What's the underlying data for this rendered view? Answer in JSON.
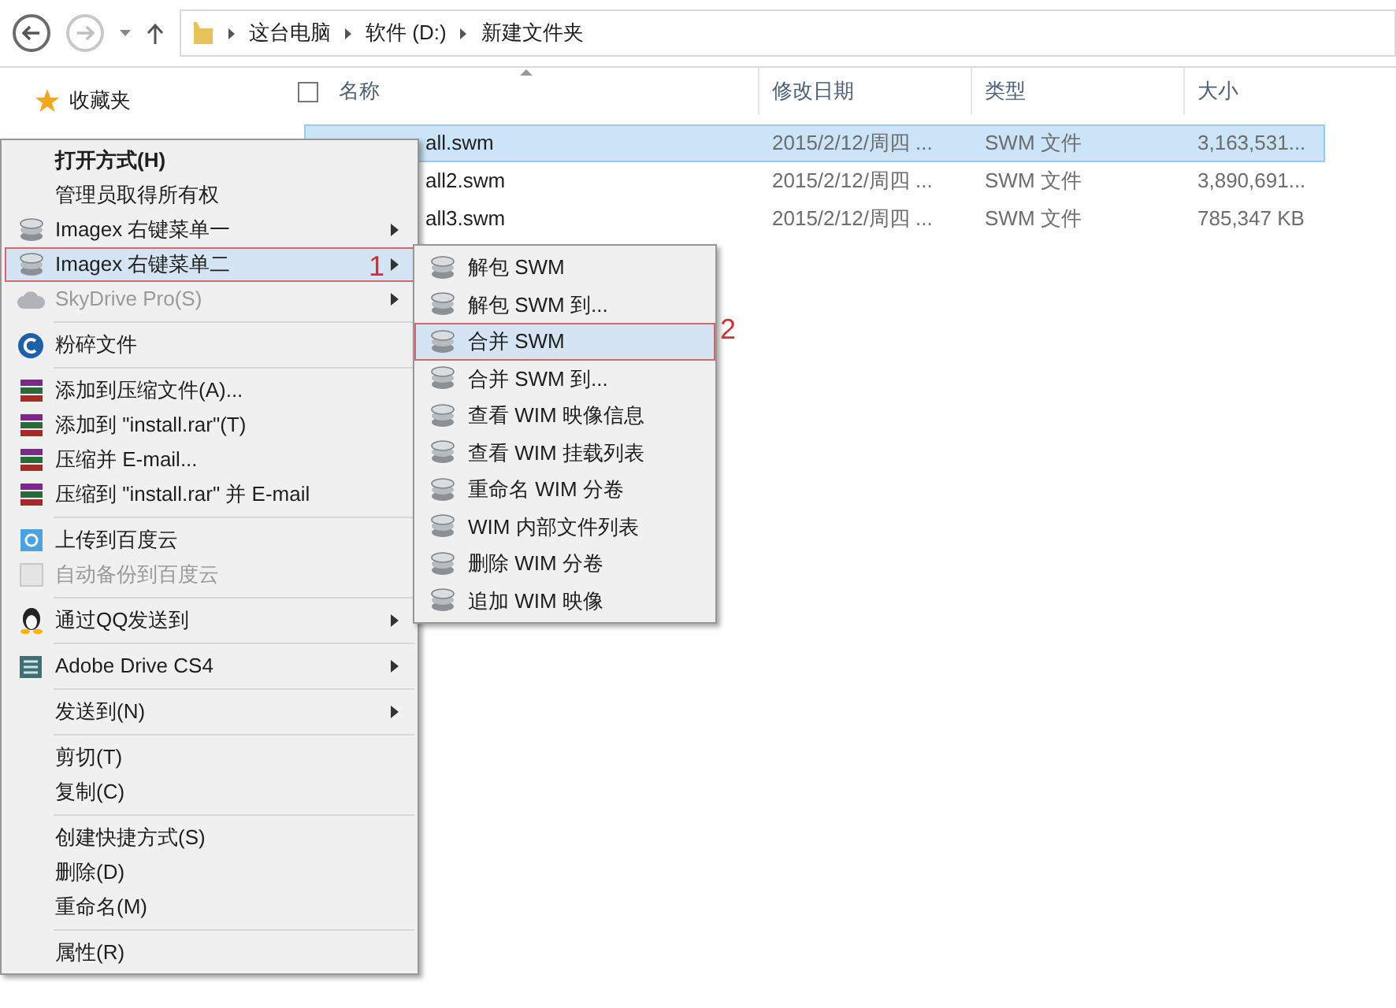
{
  "address_bar": {
    "crumbs": [
      "这台电脑",
      "软件 (D:)",
      "新建文件夹"
    ]
  },
  "nav_pane": {
    "items": [
      {
        "label": "收藏夹"
      }
    ]
  },
  "file_list": {
    "select_all": {
      "checked": false
    },
    "columns": [
      "名称",
      "修改日期",
      "类型",
      "大小"
    ],
    "rows": [
      {
        "name": "all.swm",
        "date": "2015/2/12/周四 ...",
        "type": "SWM 文件",
        "size": "3,163,531...",
        "selected": true
      },
      {
        "name": "all2.swm",
        "date": "2015/2/12/周四 ...",
        "type": "SWM 文件",
        "size": "3,890,691...",
        "selected": false
      },
      {
        "name": "all3.swm",
        "date": "2015/2/12/周四 ...",
        "type": "SWM 文件",
        "size": "785,347 KB",
        "selected": false
      }
    ]
  },
  "context_menu": {
    "items": [
      {
        "kind": "plain",
        "label": "打开方式(H)",
        "default": true,
        "selected": false,
        "disabled": false,
        "submenu": false
      },
      {
        "kind": "plain",
        "label": "管理员取得所有权",
        "default": false,
        "selected": false,
        "disabled": false,
        "submenu": false
      },
      {
        "kind": "imagex",
        "label": "Imagex 右键菜单一",
        "default": false,
        "selected": false,
        "disabled": false,
        "submenu": true
      },
      {
        "kind": "imagex",
        "label": "Imagex 右键菜单二",
        "default": false,
        "selected": true,
        "disabled": false,
        "submenu": true,
        "annotation": "1"
      },
      {
        "kind": "skydrive",
        "label": "SkyDrive Pro(S)",
        "default": false,
        "selected": false,
        "disabled": true,
        "submenu": true
      },
      {
        "kind": "separator"
      },
      {
        "kind": "shredder",
        "label": "粉碎文件",
        "default": false,
        "selected": false,
        "disabled": false,
        "submenu": false
      },
      {
        "kind": "separator"
      },
      {
        "kind": "archive",
        "label": "添加到压缩文件(A)...",
        "default": false,
        "selected": false,
        "disabled": false,
        "submenu": false
      },
      {
        "kind": "archive",
        "label": "添加到 \"install.rar\"(T)",
        "default": false,
        "selected": false,
        "disabled": false,
        "submenu": false
      },
      {
        "kind": "archive",
        "label": "压缩并 E-mail...",
        "default": false,
        "selected": false,
        "disabled": false,
        "submenu": false
      },
      {
        "kind": "archive",
        "label": "压缩到 \"install.rar\" 并 E-mail",
        "default": false,
        "selected": false,
        "disabled": false,
        "submenu": false
      },
      {
        "kind": "separator"
      },
      {
        "kind": "cloud",
        "label": "上传到百度云",
        "default": false,
        "selected": false,
        "disabled": false,
        "submenu": false
      },
      {
        "kind": "cloud",
        "label": "自动备份到百度云",
        "default": false,
        "selected": false,
        "disabled": true,
        "submenu": false
      },
      {
        "kind": "separator"
      },
      {
        "kind": "qq",
        "label": "通过QQ发送到",
        "default": false,
        "selected": false,
        "disabled": false,
        "submenu": true
      },
      {
        "kind": "separator"
      },
      {
        "kind": "adobe",
        "label": "Adobe Drive CS4",
        "default": false,
        "selected": false,
        "disabled": false,
        "submenu": true
      },
      {
        "kind": "separator"
      },
      {
        "kind": "plain",
        "label": "发送到(N)",
        "default": false,
        "selected": false,
        "disabled": false,
        "submenu": true
      },
      {
        "kind": "separator"
      },
      {
        "kind": "plain",
        "label": "剪切(T)",
        "default": false,
        "selected": false,
        "disabled": false,
        "submenu": false
      },
      {
        "kind": "plain",
        "label": "复制(C)",
        "default": false,
        "selected": false,
        "disabled": false,
        "submenu": false
      },
      {
        "kind": "separator"
      },
      {
        "kind": "plain",
        "label": "创建快捷方式(S)",
        "default": false,
        "selected": false,
        "disabled": false,
        "submenu": false
      },
      {
        "kind": "plain",
        "label": "删除(D)",
        "default": false,
        "selected": false,
        "disabled": false,
        "submenu": false
      },
      {
        "kind": "plain",
        "label": "重命名(M)",
        "default": false,
        "selected": false,
        "disabled": false,
        "submenu": false
      },
      {
        "kind": "separator"
      },
      {
        "kind": "plain",
        "label": "属性(R)",
        "default": false,
        "selected": false,
        "disabled": false,
        "submenu": false
      }
    ]
  },
  "submenu": {
    "items": [
      {
        "label": "解包 SWM",
        "selected": false
      },
      {
        "label": "解包 SWM 到...",
        "selected": false
      },
      {
        "label": "合并 SWM",
        "selected": true,
        "annotation": "2"
      },
      {
        "label": "合并 SWM 到...",
        "selected": false
      },
      {
        "label": "查看 WIM 映像信息",
        "selected": false
      },
      {
        "label": "查看 WIM 挂载列表",
        "selected": false
      },
      {
        "label": "重命名 WIM 分卷",
        "selected": false
      },
      {
        "label": "WIM 内部文件列表",
        "selected": false
      },
      {
        "label": "删除 WIM 分卷",
        "selected": false
      },
      {
        "label": "追加 WIM 映像",
        "selected": false
      }
    ]
  }
}
